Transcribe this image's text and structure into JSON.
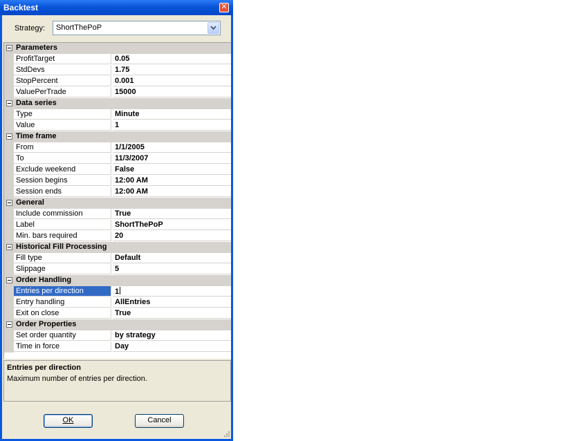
{
  "window": {
    "title": "Backtest"
  },
  "strategy": {
    "label": "Strategy:",
    "value": "ShortThePoP"
  },
  "categories": [
    {
      "name": "Parameters",
      "props": [
        {
          "name": "ProfitTarget",
          "value": "0.05"
        },
        {
          "name": "StdDevs",
          "value": "1.75"
        },
        {
          "name": "StopPercent",
          "value": "0.001"
        },
        {
          "name": "ValuePerTrade",
          "value": "15000"
        }
      ]
    },
    {
      "name": "Data series",
      "props": [
        {
          "name": "Type",
          "value": "Minute"
        },
        {
          "name": "Value",
          "value": "1"
        }
      ]
    },
    {
      "name": "Time frame",
      "props": [
        {
          "name": "From",
          "value": "1/1/2005"
        },
        {
          "name": "To",
          "value": "11/3/2007"
        },
        {
          "name": "Exclude weekend",
          "value": "False"
        },
        {
          "name": "Session begins",
          "value": "12:00 AM"
        },
        {
          "name": "Session ends",
          "value": "12:00 AM"
        }
      ]
    },
    {
      "name": "General",
      "props": [
        {
          "name": "Include commission",
          "value": "True"
        },
        {
          "name": "Label",
          "value": "ShortThePoP"
        },
        {
          "name": "Min. bars required",
          "value": "20"
        }
      ]
    },
    {
      "name": "Historical Fill Processing",
      "props": [
        {
          "name": "Fill type",
          "value": "Default"
        },
        {
          "name": "Slippage",
          "value": "5"
        }
      ]
    },
    {
      "name": "Order Handling",
      "props": [
        {
          "name": "Entries per direction",
          "value": "1",
          "selected": true
        },
        {
          "name": "Entry handling",
          "value": "AllEntries"
        },
        {
          "name": "Exit on close",
          "value": "True"
        }
      ]
    },
    {
      "name": "Order Properties",
      "props": [
        {
          "name": "Set order quantity",
          "value": "by strategy"
        },
        {
          "name": "Time in force",
          "value": "Day"
        }
      ]
    }
  ],
  "help": {
    "title": "Entries per direction",
    "description": "Maximum number of entries per direction."
  },
  "buttons": {
    "ok": "OK",
    "cancel": "Cancel"
  },
  "colors": {
    "title_bar": "#0a55d8",
    "selection": "#316ac5",
    "category_bg": "#d6d3ce",
    "dialog_bg": "#ece9d8"
  }
}
